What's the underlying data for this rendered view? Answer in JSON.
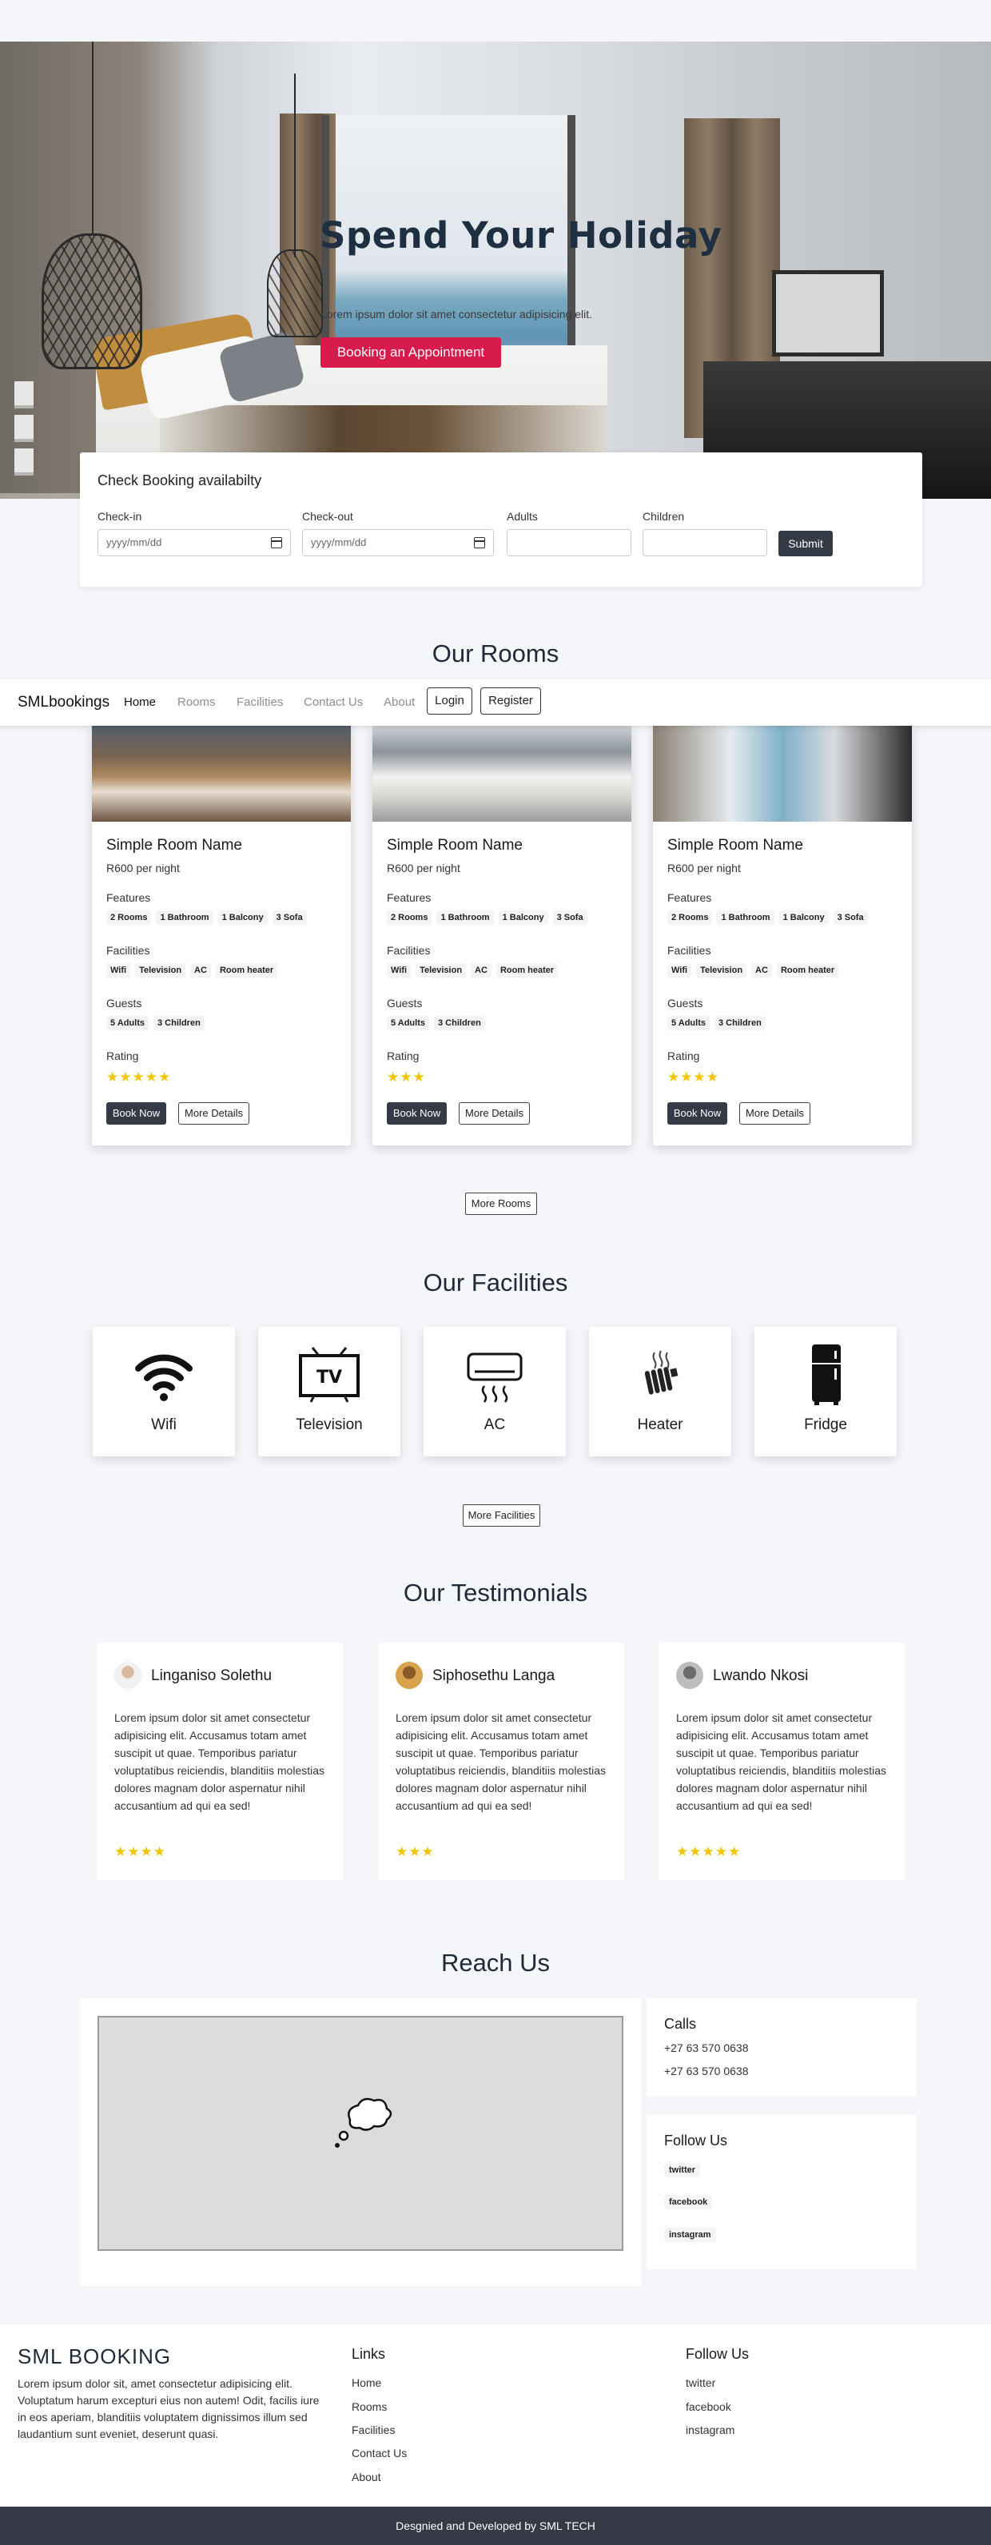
{
  "hero": {
    "title": "Spend Your Holiday",
    "subtitle": "Lorem ipsum dolor sit amet consectetur adipisicing elit.",
    "cta_label": "Booking an Appointment"
  },
  "booking": {
    "title": "Check Booking availabilty",
    "checkin_label": "Check-in",
    "checkin_placeholder": "yyyy/mm/dd",
    "checkout_label": "Check-out",
    "checkout_placeholder": "yyyy/mm/dd",
    "adults_label": "Adults",
    "children_label": "Children",
    "submit_label": "Submit"
  },
  "rooms_section": {
    "title": "Our Rooms",
    "more_label": "More Rooms"
  },
  "navbar": {
    "brand": "SMLbookings",
    "items": [
      "Home",
      "Rooms",
      "Facilities",
      "Contact Us",
      "About"
    ],
    "login_label": "Login",
    "register_label": "Register"
  },
  "rooms": [
    {
      "name": "Simple Room Name",
      "price": "R600 per night",
      "features_label": "Features",
      "features": [
        "2 Rooms",
        "1 Bathroom",
        "1 Balcony",
        "3 Sofa"
      ],
      "facilities_label": "Facilities",
      "facilities": [
        "Wifi",
        "Television",
        "AC",
        "Room heater"
      ],
      "guests_label": "Guests",
      "guests": [
        "5 Adults",
        "3 Children"
      ],
      "rating_label": "Rating",
      "rating": 5,
      "stars": "★★★★★",
      "book_label": "Book Now",
      "details_label": "More Details"
    },
    {
      "name": "Simple Room Name",
      "price": "R600 per night",
      "features_label": "Features",
      "features": [
        "2 Rooms",
        "1 Bathroom",
        "1 Balcony",
        "3 Sofa"
      ],
      "facilities_label": "Facilities",
      "facilities": [
        "Wifi",
        "Television",
        "AC",
        "Room heater"
      ],
      "guests_label": "Guests",
      "guests": [
        "5 Adults",
        "3 Children"
      ],
      "rating_label": "Rating",
      "rating": 3,
      "stars": "★★★",
      "book_label": "Book Now",
      "details_label": "More Details"
    },
    {
      "name": "Simple Room Name",
      "price": "R600 per night",
      "features_label": "Features",
      "features": [
        "2 Rooms",
        "1 Bathroom",
        "1 Balcony",
        "3 Sofa"
      ],
      "facilities_label": "Facilities",
      "facilities": [
        "Wifi",
        "Television",
        "AC",
        "Room heater"
      ],
      "guests_label": "Guests",
      "guests": [
        "5 Adults",
        "3 Children"
      ],
      "rating_label": "Rating",
      "rating": 4,
      "stars": "★★★★",
      "book_label": "Book Now",
      "details_label": "More Details"
    }
  ],
  "facilities_section": {
    "title": "Our Facilities",
    "more_label": "More Facilities",
    "items": [
      {
        "label": "Wifi",
        "icon": "wifi-icon"
      },
      {
        "label": "Television",
        "icon": "tv-icon"
      },
      {
        "label": "AC",
        "icon": "ac-icon"
      },
      {
        "label": "Heater",
        "icon": "heater-icon"
      },
      {
        "label": "Fridge",
        "icon": "fridge-icon"
      }
    ]
  },
  "testimonials_section": {
    "title": "Our Testimonials",
    "items": [
      {
        "name": "Linganiso Solethu",
        "text": "Lorem ipsum dolor sit amet consectetur adipisicing elit. Accusamus totam amet suscipit ut quae. Temporibus pariatur voluptatibus reiciendis, blanditiis molestias dolores magnam dolor aspernatur nihil accusantium ad qui ea sed!",
        "rating": 4,
        "stars": "★★★★"
      },
      {
        "name": "Siphosethu Langa",
        "text": "Lorem ipsum dolor sit amet consectetur adipisicing elit. Accusamus totam amet suscipit ut quae. Temporibus pariatur voluptatibus reiciendis, blanditiis molestias dolores magnam dolor aspernatur nihil accusantium ad qui ea sed!",
        "rating": 3,
        "stars": "★★★"
      },
      {
        "name": "Lwando Nkosi",
        "text": "Lorem ipsum dolor sit amet consectetur adipisicing elit. Accusamus totam amet suscipit ut quae. Temporibus pariatur voluptatibus reiciendis, blanditiis molestias dolores magnam dolor aspernatur nihil accusantium ad qui ea sed!",
        "rating": 5,
        "stars": "★★★★★"
      }
    ]
  },
  "reach_section": {
    "title": "Reach Us",
    "calls_title": "Calls",
    "phones": [
      "+27 63 570 0638",
      "+27 63 570 0638"
    ],
    "follow_title": "Follow Us",
    "socials": [
      "twitter",
      "facebook",
      "instagram"
    ]
  },
  "footer": {
    "brand": "SML BOOKING",
    "about": "Lorem ipsum dolor sit, amet consectetur adipisicing elit. Voluptatum harum excepturi eius non autem! Odit, facilis iure in eos aperiam, blanditiis voluptatem dignissimos illum sed laudantium sunt eveniet, deserunt quasi.",
    "links_title": "Links",
    "links": [
      "Home",
      "Rooms",
      "Facilities",
      "Contact Us",
      "About"
    ],
    "follow_title": "Follow Us",
    "follow": [
      "twitter",
      "facebook",
      "instagram"
    ],
    "copyright": "Desgnied and Developed by SML TECH"
  },
  "colors": {
    "accent": "#d81b4d",
    "dark": "#343a46",
    "star": "#f2c500",
    "page_bg": "#f5f6fa"
  }
}
